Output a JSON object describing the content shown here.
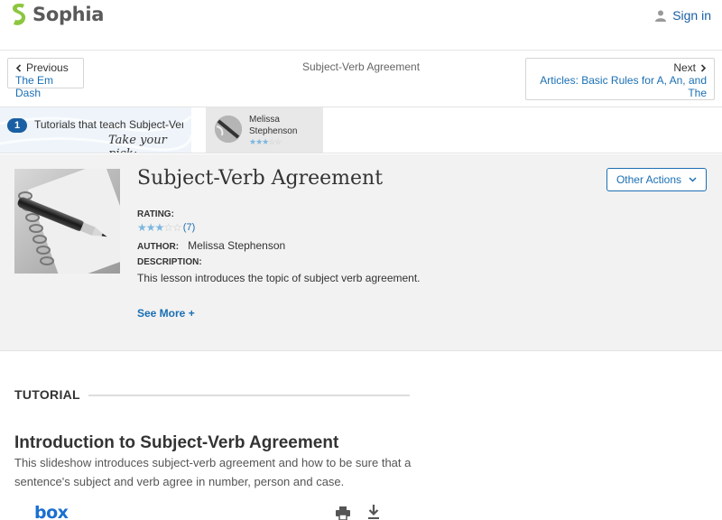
{
  "header": {
    "brand": "Sophia",
    "signin_label": "Sign in"
  },
  "nav": {
    "prev_label": "Previous",
    "prev_link": "The Em Dash",
    "center_title": "Subject-Verb Agreement",
    "next_label": "Next",
    "next_link": "Articles: Basic Rules for A, An, and The"
  },
  "strip": {
    "count": "1",
    "text": "Tutorials that teach Subject-Verb Agreement",
    "pick": "Take your pick:",
    "card": {
      "name": "Melissa Stephenson",
      "stars_filled": 3,
      "stars_total": 5
    }
  },
  "lesson": {
    "title": "Subject-Verb Agreement",
    "other_actions_label": "Other Actions",
    "rating_label": "RATING:",
    "rating_stars_filled": 3,
    "rating_stars_total": 5,
    "rating_count": "(7)",
    "author_label": "AUTHOR:",
    "author": "Melissa Stephenson",
    "description_label": "DESCRIPTION:",
    "description": "This lesson introduces the topic of subject verb agreement.",
    "see_more": "See More +"
  },
  "tutorial": {
    "section_label": "TUTORIAL",
    "heading": "Introduction to Subject-Verb Agreement",
    "text": "This slideshow introduces subject-verb agreement and how to be sure that a sentence's subject and verb agree in number, person and case.",
    "embed_brand": "box"
  },
  "colors": {
    "link": "#1a6fb3",
    "brand_green": "#8dc63f",
    "star_on": "#7bb7e0",
    "panel_bg": "#f2f2f2"
  }
}
